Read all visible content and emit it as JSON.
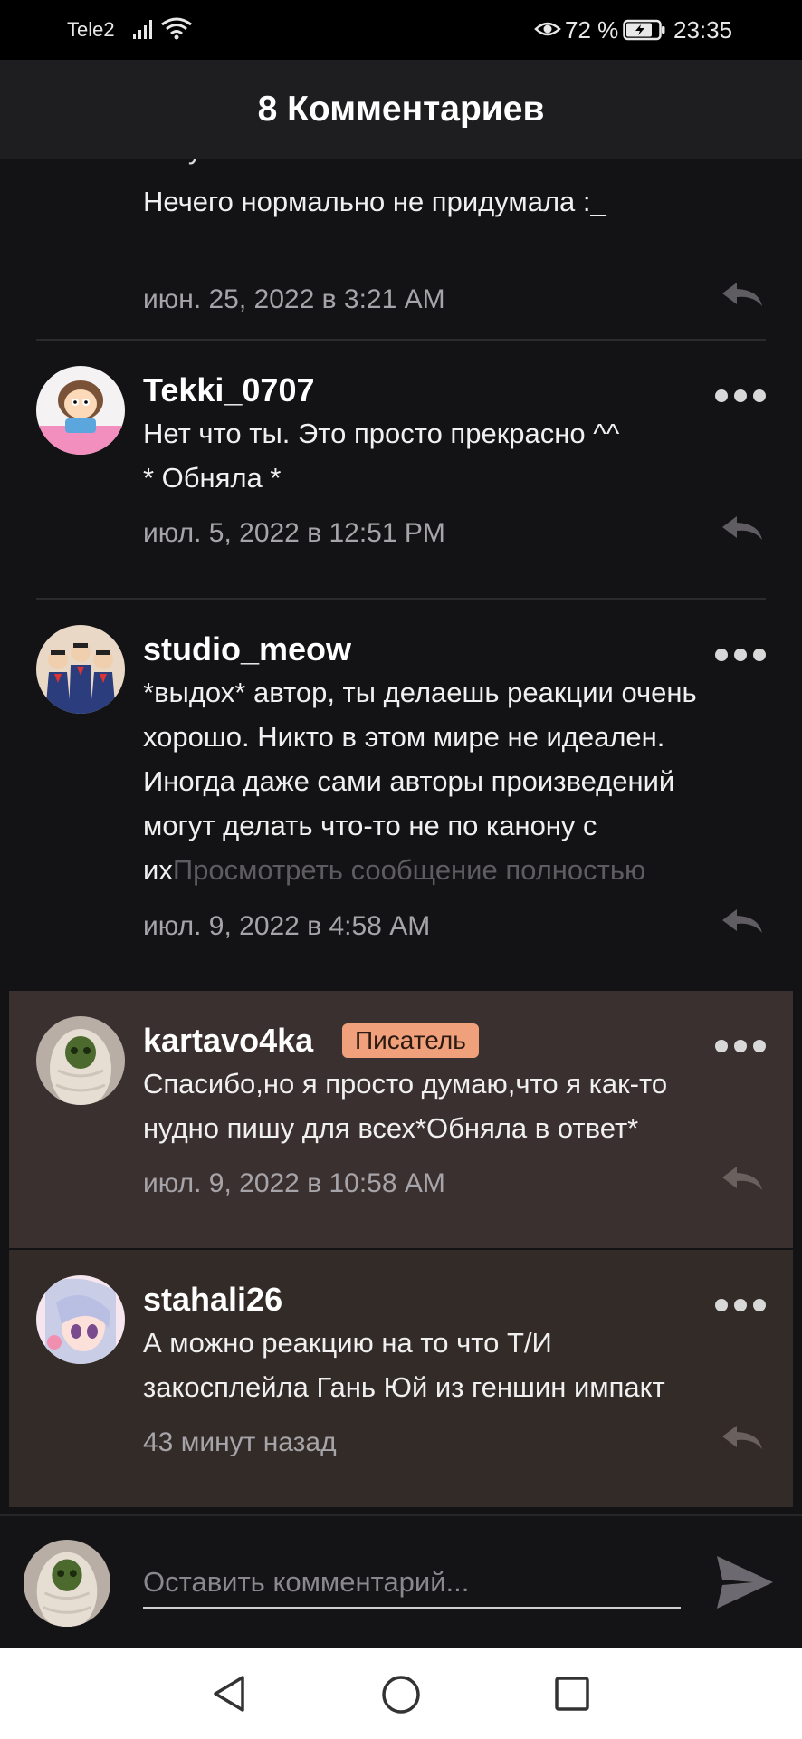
{
  "status_bar": {
    "carrier": "Tele2",
    "battery": "72 %",
    "time": "23:35"
  },
  "header": {
    "title": "8 Комментариев"
  },
  "comments": [
    {
      "text_partial_top": "могу :",
      "text": "Нечего нормально не придумала :_",
      "date": "июн. 25, 2022 в 3:21 AM"
    },
    {
      "username": "Tekki_0707",
      "text": "Нет что ты. Это просто прекрасно ^^\n* Обняла *",
      "date": "июл. 5, 2022 в 12:51 PM"
    },
    {
      "username": "studio_meow",
      "text": "*выдох* автор, ты делаешь реакции очень\nхорошо. Никто в этом мире не идеален.\nИногда даже сами авторы произведений\nмогут делать что-то не по канону с\nих",
      "read_more": "Просмотреть сообщение полностью",
      "date": "июл. 9, 2022 в 4:58 AM"
    },
    {
      "username": "kartavo4ka",
      "badge": "Писатель",
      "text": "Спасибо,но я просто думаю,что я как-то\nнудно пишу для всех*Обняла в ответ*",
      "date": "июл. 9, 2022 в 10:58 AM"
    },
    {
      "username": "stahali26",
      "text": "А можно реакцию на то что Т/И\nзакосплейла Гань Юй из геншин импакт",
      "date": "43 минут назад"
    }
  ],
  "input": {
    "placeholder": "Оставить комментарий..."
  },
  "colors": {
    "background": "#131214",
    "header": "#1e1e20",
    "highlight": "#3a302f",
    "badge": "#f0a17c"
  }
}
